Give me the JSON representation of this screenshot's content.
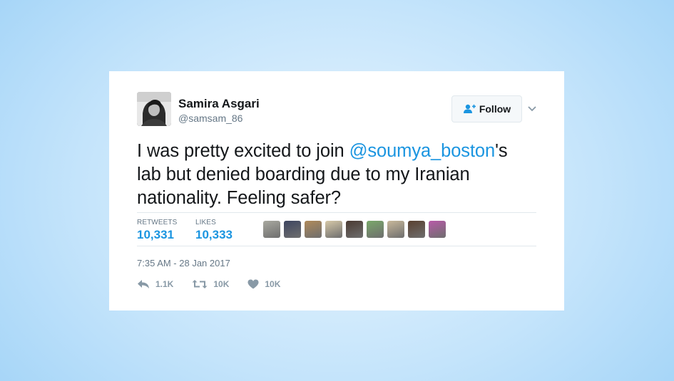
{
  "tweet": {
    "author": {
      "name": "Samira Asgari",
      "handle": "@samsam_86"
    },
    "follow_label": "Follow",
    "text_parts": {
      "pre": "I was pretty excited to join ",
      "mention": "@soumya_boston",
      "post": "'s lab but denied boarding due to my Iranian nationality. Feeling safer?"
    },
    "stats": {
      "retweets_label": "RETWEETS",
      "retweets_value": "10,331",
      "likes_label": "LIKES",
      "likes_value": "10,333"
    },
    "liker_avatars": [
      "#a9a9a0",
      "#3d4560",
      "#b08a5a",
      "#d7c9a8",
      "#4a3a32",
      "#7aa86a",
      "#c8b89a",
      "#5a4030",
      "#b85aa8"
    ],
    "timestamp": "7:35 AM - 28 Jan 2017",
    "actions": {
      "reply_count": "1.1K",
      "retweet_count": "10K",
      "like_count": "10K"
    },
    "colors": {
      "accent": "#1b95e0",
      "muted": "#657786",
      "icon": "#8899a6"
    }
  }
}
